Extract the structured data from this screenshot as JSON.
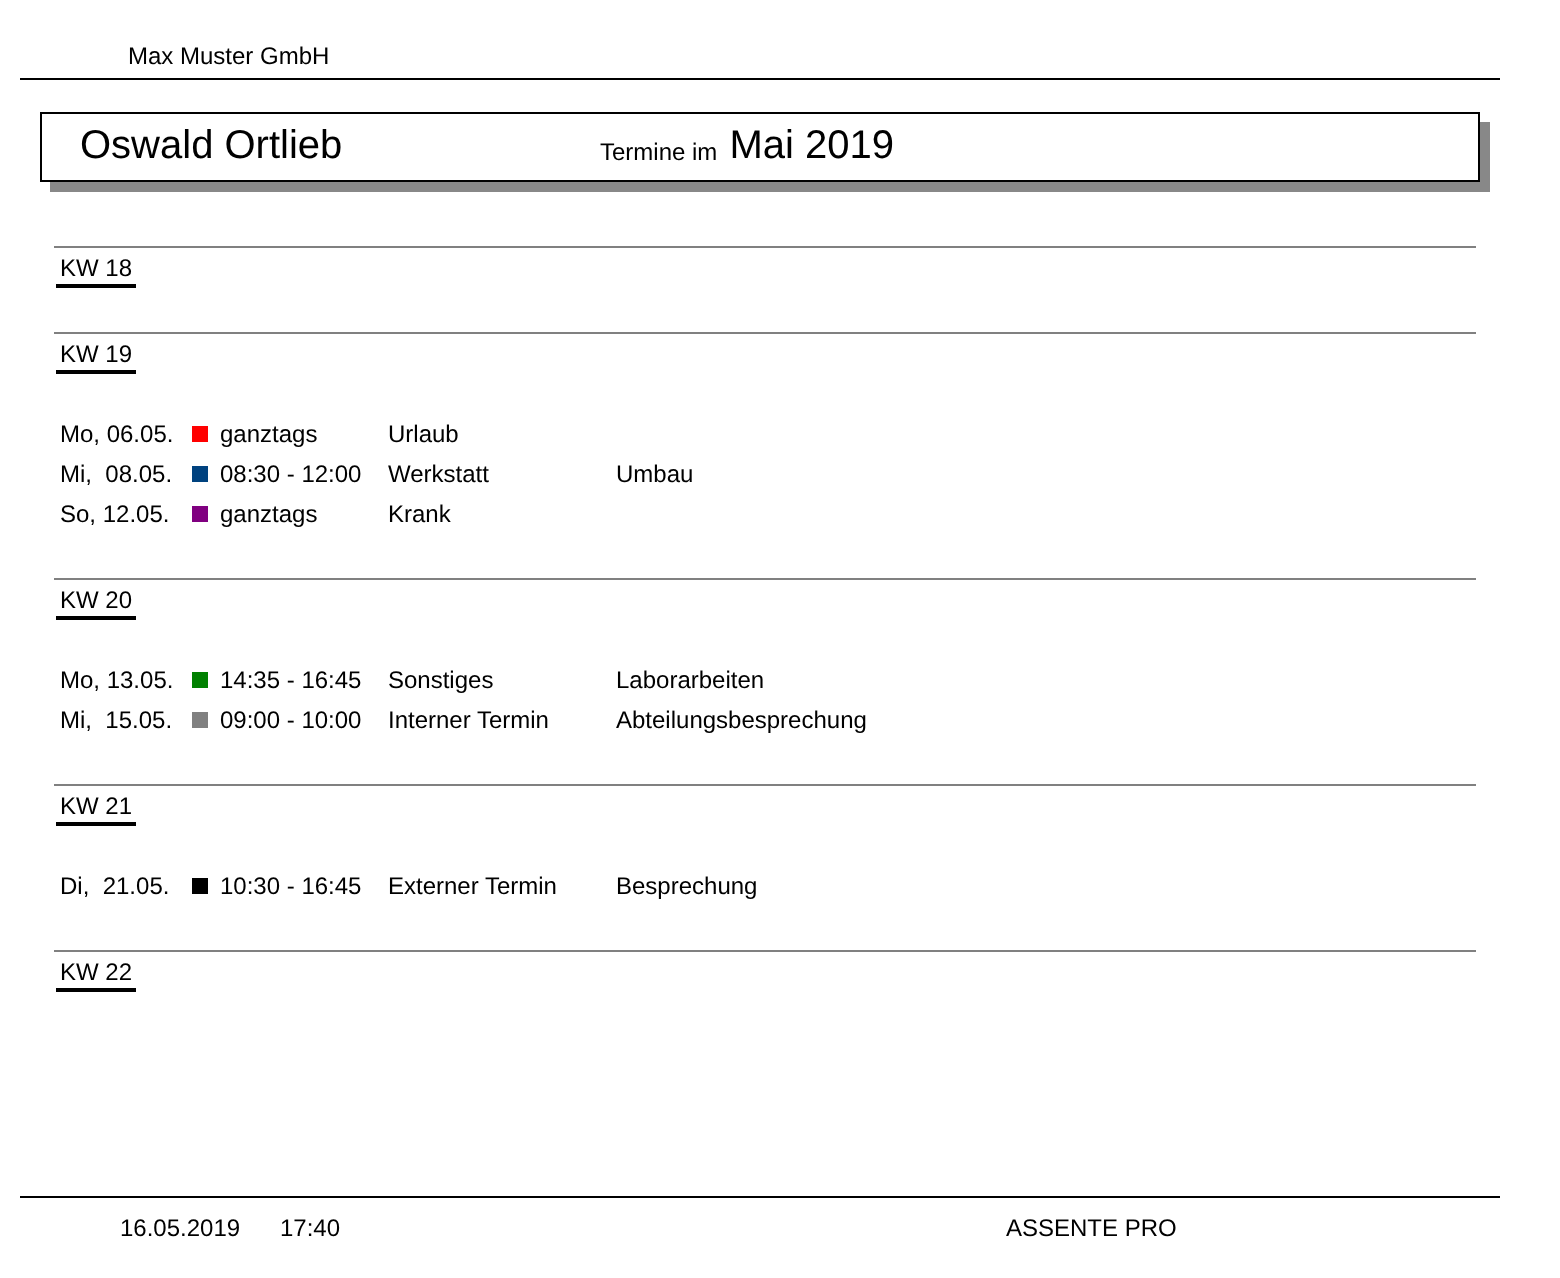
{
  "company": "Max Muster GmbH",
  "header": {
    "person": "Oswald Ortlieb",
    "caption": "Termine im",
    "month": "Mai 2019"
  },
  "weeks": [
    {
      "label": "KW 18"
    },
    {
      "label": "KW 19",
      "entries": [
        {
          "date": "Mo, 06.05.",
          "color": "#ff0000",
          "time": "ganztags",
          "category": "Urlaub"
        },
        {
          "date": "Mi,  08.05.",
          "color": "#00427f",
          "time": "08:30 - 12:00",
          "category": "Werkstatt",
          "description": "Umbau"
        },
        {
          "date": "So, 12.05.",
          "color": "#800080",
          "time": "ganztags",
          "category": "Krank"
        }
      ]
    },
    {
      "label": "KW 20",
      "entries": [
        {
          "date": "Mo, 13.05.",
          "color": "#008000",
          "time": "14:35 - 16:45",
          "category": "Sonstiges",
          "description": "Laborarbeiten"
        },
        {
          "date": "Mi,  15.05.",
          "color": "#808080",
          "time": "09:00 - 10:00",
          "category": "Interner Termin",
          "description": "Abteilungsbesprechung"
        }
      ]
    },
    {
      "label": "KW 21",
      "entries": [
        {
          "date": "Di,  21.05.",
          "color": "#000000",
          "time": "10:30 - 16:45",
          "category": "Externer Termin",
          "description": "Besprechung"
        }
      ]
    },
    {
      "label": "KW 22"
    }
  ],
  "footer": {
    "date": "16.05.2019",
    "time": "17:40",
    "product": "ASSENTE PRO"
  }
}
